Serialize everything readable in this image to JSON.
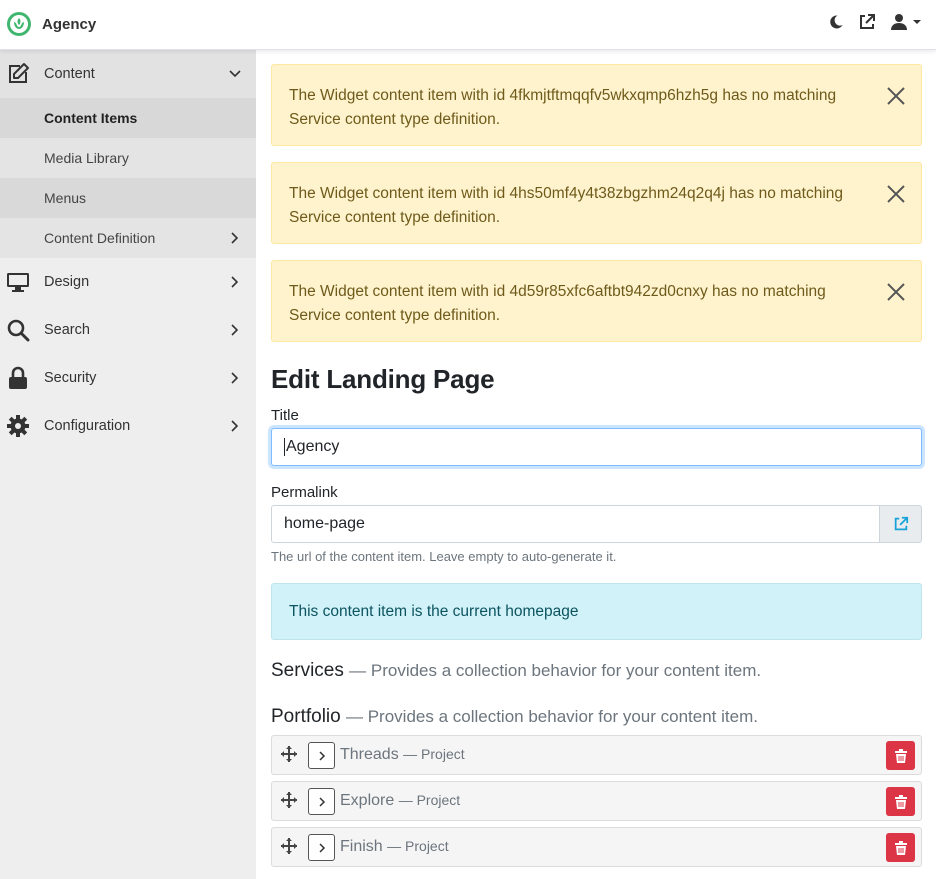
{
  "app": {
    "name": "Agency"
  },
  "sidebar": {
    "content": {
      "label": "Content",
      "items": [
        {
          "label": "Content Items"
        },
        {
          "label": "Media Library"
        },
        {
          "label": "Menus"
        },
        {
          "label": "Content Definition"
        }
      ]
    },
    "design": {
      "label": "Design"
    },
    "search": {
      "label": "Search"
    },
    "security": {
      "label": "Security"
    },
    "configuration": {
      "label": "Configuration"
    }
  },
  "alerts": [
    {
      "line1": "The Widget content item with id 4fkmjtftmqqfv5wkxqmp6hzh5g has no matching",
      "line2": "Service content type definition."
    },
    {
      "line1": "The Widget content item with id 4hs50mf4y4t38zbgzhm24q2q4j has no matching",
      "line2": "Service content type definition."
    },
    {
      "line1": "The Widget content item with id 4d59r85xfc6aftbt942zd0cnxy has no matching",
      "line2": "Service content type definition."
    }
  ],
  "page": {
    "title": "Edit Landing Page"
  },
  "form": {
    "title_label": "Title",
    "title_value": "Agency",
    "permalink_label": "Permalink",
    "permalink_value": "home-page",
    "permalink_hint": "The url of the content item. Leave empty to auto-generate it.",
    "homepage_info": "This content item is the current homepage"
  },
  "services": {
    "name": "Services",
    "desc": "— Provides a collection behavior for your content item."
  },
  "portfolio": {
    "name": "Portfolio",
    "desc": "— Provides a collection behavior for your content item.",
    "items": [
      {
        "title": "Threads",
        "type": "— Project"
      },
      {
        "title": "Explore",
        "type": "— Project"
      },
      {
        "title": "Finish",
        "type": "— Project"
      }
    ]
  },
  "colors": {
    "brand": "#41b670",
    "danger": "#dc3545",
    "link": "#17a2d8"
  }
}
